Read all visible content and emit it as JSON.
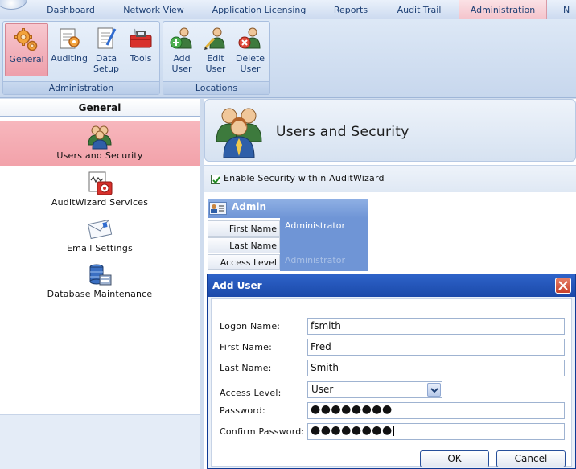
{
  "tabs": [
    {
      "label": "Dashboard",
      "active": false
    },
    {
      "label": "Network View",
      "active": false
    },
    {
      "label": "Application Licensing",
      "active": false
    },
    {
      "label": "Reports",
      "active": false
    },
    {
      "label": "Audit Trail",
      "active": false
    },
    {
      "label": "Administration",
      "active": true
    },
    {
      "label": "N",
      "active": false
    }
  ],
  "ribbon": {
    "groups": [
      {
        "label": "Administration",
        "buttons": [
          {
            "label": "General",
            "icon": "gears-icon",
            "selected": true
          },
          {
            "label": "Auditing",
            "icon": "auditing-icon",
            "selected": false
          },
          {
            "label": "Data\nSetup",
            "icon": "data-setup-icon",
            "selected": false
          },
          {
            "label": "Tools",
            "icon": "toolbox-icon",
            "selected": false
          }
        ]
      },
      {
        "label": "Locations",
        "buttons": [
          {
            "label": "Add\nUser",
            "icon": "add-user-icon",
            "selected": false
          },
          {
            "label": "Edit\nUser",
            "icon": "edit-user-icon",
            "selected": false
          },
          {
            "label": "Delete\nUser",
            "icon": "delete-user-icon",
            "selected": false
          }
        ]
      }
    ]
  },
  "left_panel": {
    "title": "General",
    "items": [
      {
        "label": "Users and Security",
        "icon": "users-icon",
        "active": true
      },
      {
        "label": "AuditWizard Services",
        "icon": "services-icon",
        "active": false
      },
      {
        "label": "Email Settings",
        "icon": "email-icon",
        "active": false
      },
      {
        "label": "Database Maintenance",
        "icon": "database-icon",
        "active": false
      }
    ]
  },
  "content": {
    "title": "Users and Security",
    "enable_security_label": "Enable Security within AuditWizard",
    "enable_security_checked": true,
    "admin_card": {
      "title": "Admin",
      "fields": [
        {
          "label": "First Name",
          "value": "Administrator"
        },
        {
          "label": "Last Name",
          "value": ""
        },
        {
          "label": "Access Level",
          "value": "Administrator"
        }
      ]
    }
  },
  "dialog": {
    "title": "Add User",
    "fields": {
      "logon_name": {
        "label": "Logon Name:",
        "value": "fsmith"
      },
      "first_name": {
        "label": "First Name:",
        "value": "Fred"
      },
      "last_name": {
        "label": "Last Name:",
        "value": "Smith"
      },
      "access_level": {
        "label": "Access Level:",
        "value": "User"
      },
      "password": {
        "label": "Password:",
        "value": "●●●●●●●●"
      },
      "confirm_password": {
        "label": "Confirm Password:",
        "value": "●●●●●●●●"
      }
    },
    "ok_label": "OK",
    "cancel_label": "Cancel"
  },
  "colors": {
    "accent_tab": "#f4c3cb",
    "selected_nav": "#f2a2aa",
    "dialog_title": "#1b49a9",
    "admin_card": "#6f95d6"
  }
}
